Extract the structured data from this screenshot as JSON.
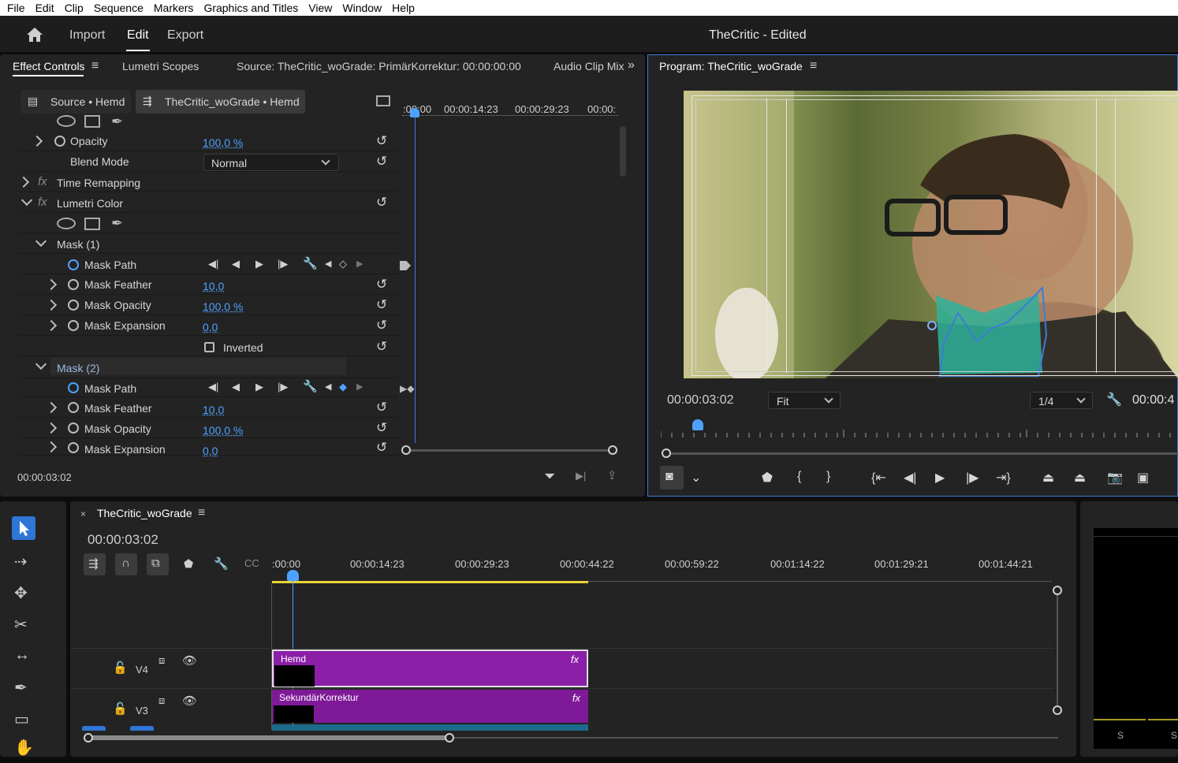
{
  "menu": [
    "File",
    "Edit",
    "Clip",
    "Sequence",
    "Markers",
    "Graphics and Titles",
    "View",
    "Window",
    "Help"
  ],
  "header": {
    "nav": [
      "Import",
      "Edit",
      "Export"
    ],
    "active": "Edit",
    "project_title": "TheCritic - Edited"
  },
  "effect_panel": {
    "tabs": [
      "Effect Controls",
      "Lumetri Scopes",
      "Source: TheCritic_woGrade: PrimärKorrektur: 00:00:00:00",
      "Audio Clip Mix"
    ],
    "source_label": "Source • Hemd",
    "clip_label": "TheCritic_woGrade • Hemd",
    "ruler": [
      ":00:00",
      "00:00:14:23",
      "00:00:29:23",
      "00:00:"
    ],
    "rows": {
      "opacity": {
        "label": "Opacity",
        "value": "100,0 %"
      },
      "blend_mode": {
        "label": "Blend Mode",
        "value": "Normal"
      },
      "time_remapping": "Time Remapping",
      "lumetri_color": "Lumetri Color",
      "mask1": "Mask (1)",
      "mask2": "Mask (2)",
      "mask_path": "Mask Path",
      "mask_feather": {
        "label": "Mask Feather",
        "value": "10,0"
      },
      "mask_opacity": {
        "label": "Mask Opacity",
        "value": "100,0 %"
      },
      "mask_expansion": {
        "label": "Mask Expansion",
        "value": "0,0"
      },
      "inverted": "Inverted"
    },
    "timecode": "00:00:03:02"
  },
  "program": {
    "title": "Program: TheCritic_woGrade",
    "timecode": "00:00:03:02",
    "fit": "Fit",
    "resolution": "1/4",
    "duration": "00:00:4"
  },
  "timeline": {
    "sequence": "TheCritic_woGrade",
    "timecode": "00:00:03:02",
    "ruler": [
      ":00:00",
      "00:00:14:23",
      "00:00:29:23",
      "00:00:44:22",
      "00:00:59:22",
      "00:01:14:22",
      "00:01:29:21",
      "00:01:44:21"
    ],
    "tracks": [
      {
        "name": "V4",
        "clip": "Hemd"
      },
      {
        "name": "V3",
        "clip": "SekundärKorrektur"
      }
    ],
    "fx_label": "fx"
  },
  "meter": {
    "labels": [
      "S",
      "S"
    ]
  },
  "colors": {
    "accent": "#4ea2ff",
    "clip": "#8b1fa8",
    "work_area": "#e6d23a"
  }
}
